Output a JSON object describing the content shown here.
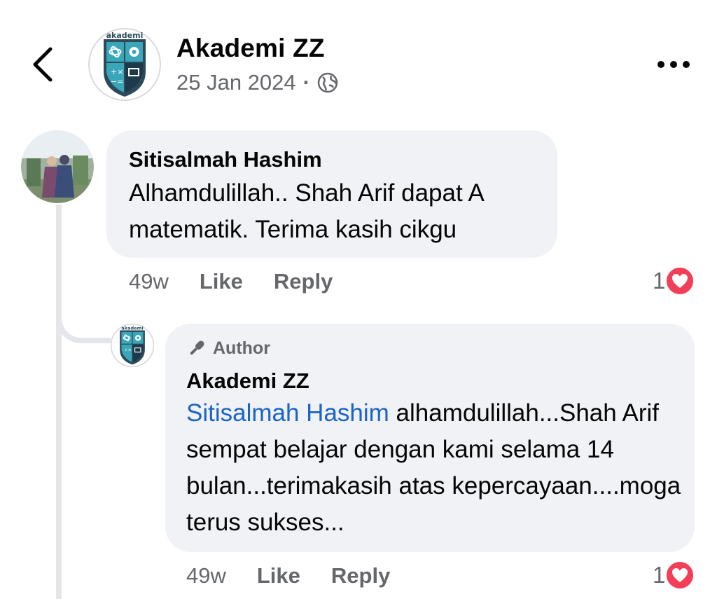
{
  "header": {
    "page_name": "Akademi ZZ",
    "date": "25 Jan 2024",
    "separator": "·",
    "logo_text": "akademi",
    "icons": [
      "back-chevron-icon",
      "globe-icon",
      "more-dots-icon"
    ]
  },
  "comment": {
    "author": "Sitisalmah Hashim",
    "text": "Alhamdulillah.. Shah Arif dapat A matematik. Terima kasih cikgu",
    "time": "49w",
    "like_label": "Like",
    "reply_label": "Reply",
    "reaction_count": "1"
  },
  "reply": {
    "badge": "Author",
    "author": "Akademi ZZ",
    "mention": "Sitisalmah Hashim",
    "text": " alhamdulillah...Shah Arif sempat belajar dengan kami selama 14 bulan...terimakasih atas kepercayaan....moga terus sukses...",
    "time": "49w",
    "like_label": "Like",
    "reply_label": "Reply",
    "reaction_count": "1"
  },
  "colors": {
    "bubble": "#f0f2f5",
    "mention": "#1b63c7",
    "love_reaction": "#f33e58",
    "secondary_text": "#65676b"
  }
}
